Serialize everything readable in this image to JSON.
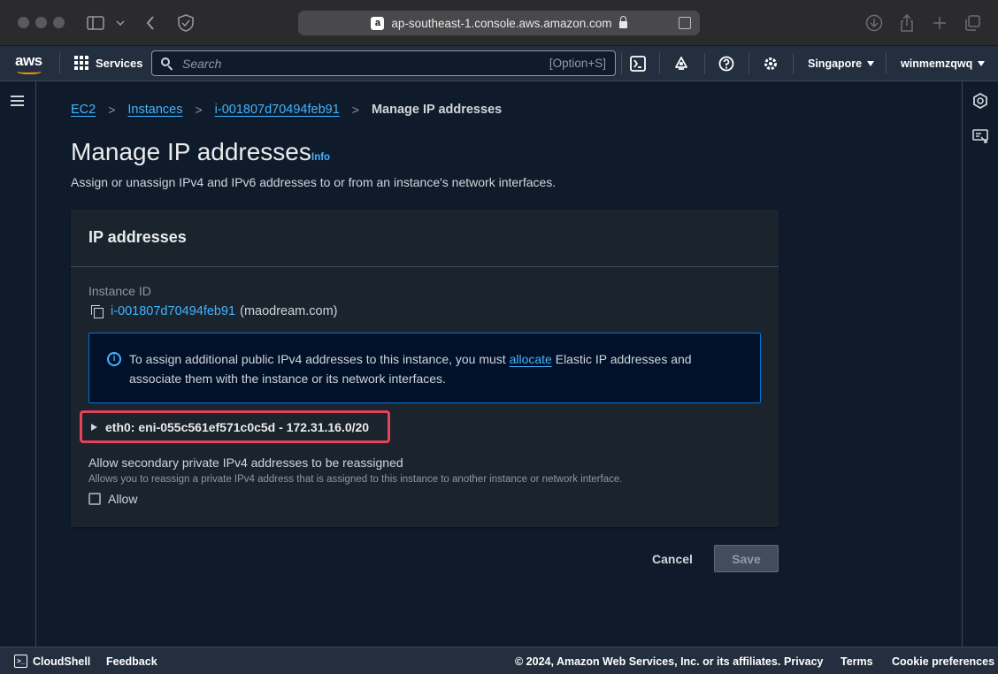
{
  "browser": {
    "url": "ap-southeast-1.console.aws.amazon.com",
    "favicon_letter": "a"
  },
  "topnav": {
    "logo": "aws",
    "services_label": "Services",
    "search_placeholder": "Search",
    "search_shortcut": "[Option+S]",
    "region_label": "Singapore",
    "account_label": "winmemzqwq"
  },
  "breadcrumb": {
    "items": [
      "EC2",
      "Instances",
      "i-001807d70494feb91"
    ],
    "current": "Manage IP addresses"
  },
  "page": {
    "title": "Manage IP addresses",
    "info_label": "Info",
    "subtitle": "Assign or unassign IPv4 and IPv6 addresses to or from an instance's network interfaces."
  },
  "panel": {
    "title": "IP addresses",
    "instance_id_label": "Instance ID",
    "instance_id": "i-001807d70494feb91",
    "instance_name": "(maodream.com)",
    "alert": {
      "text_before": "To assign additional public IPv4 addresses to this instance, you must ",
      "link": "allocate",
      "text_after": " Elastic IP addresses and associate them with the instance or its network interfaces."
    },
    "interface_label": "eth0: eni-055c561ef571c0c5d - 172.31.16.0/20",
    "reassign_label": "Allow secondary private IPv4 addresses to be reassigned",
    "reassign_desc": "Allows you to reassign a private IPv4 address that is assigned to this instance to another instance or network interface.",
    "allow_label": "Allow",
    "allow_checked": false
  },
  "actions": {
    "cancel_label": "Cancel",
    "save_label": "Save"
  },
  "footer": {
    "cloudshell_label": "CloudShell",
    "feedback_label": "Feedback",
    "copyright": "© 2024, Amazon Web Services, Inc. or its affiliates.",
    "privacy": "Privacy",
    "terms": "Terms",
    "cookie": "Cookie preferences"
  },
  "colors": {
    "link": "#42b4ff",
    "highlight_border": "#e8425b",
    "alert_border": "#0972d3",
    "aws_orange": "#ff9900"
  }
}
